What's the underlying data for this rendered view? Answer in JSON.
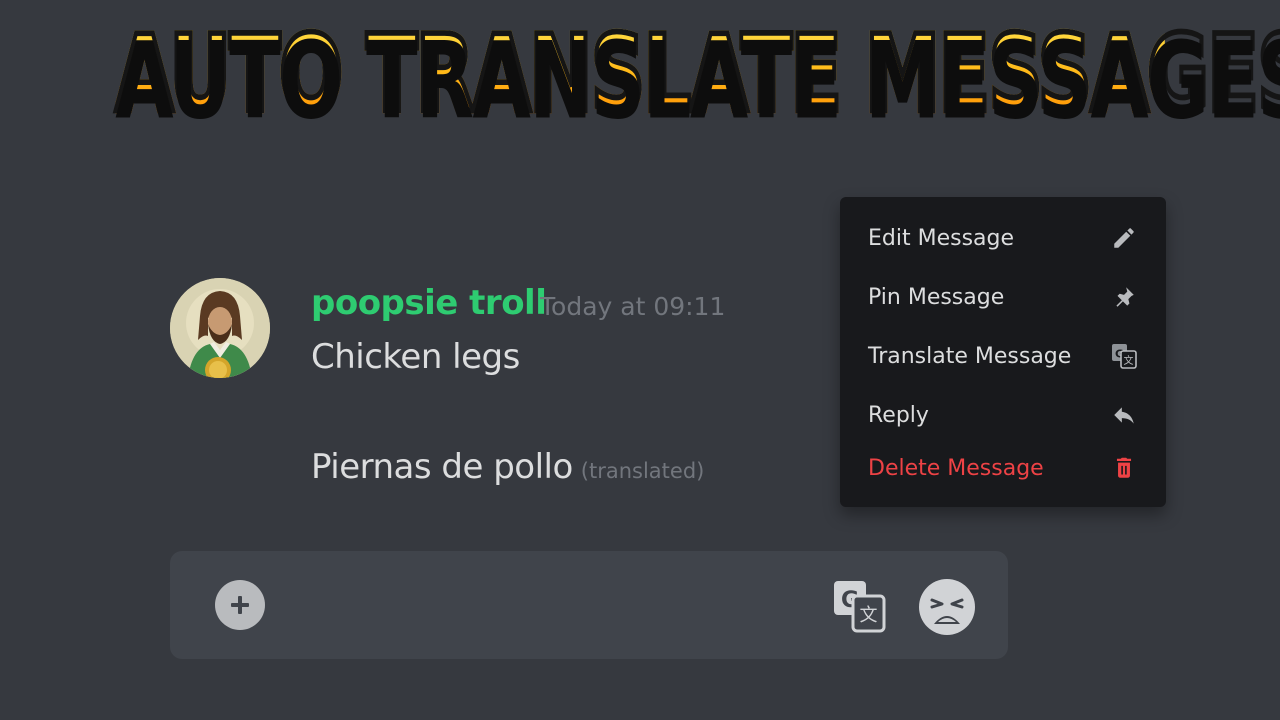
{
  "banner": {
    "title": "AUTO TRANSLATE MESSAGES"
  },
  "message": {
    "username": "poopsie troll",
    "username_color": "#2ecc71",
    "timestamp": "Today at 09:11",
    "text": "Chicken legs",
    "translated_text": "Piernas de pollo",
    "translated_tag": "(translated)"
  },
  "context_menu": {
    "items": [
      {
        "label": "Edit Message",
        "icon": "pencil-icon"
      },
      {
        "label": "Pin Message",
        "icon": "pin-icon"
      },
      {
        "label": "Translate Message",
        "icon": "translate-icon"
      },
      {
        "label": "Reply",
        "icon": "reply-icon"
      },
      {
        "label": "Delete Message",
        "icon": "trash-icon",
        "color": "#ed4245"
      }
    ]
  },
  "input_bar": {
    "plus_icon": "plus-icon",
    "translate_icon": "translate-icon",
    "emoji_icon": "weary-face-icon"
  }
}
